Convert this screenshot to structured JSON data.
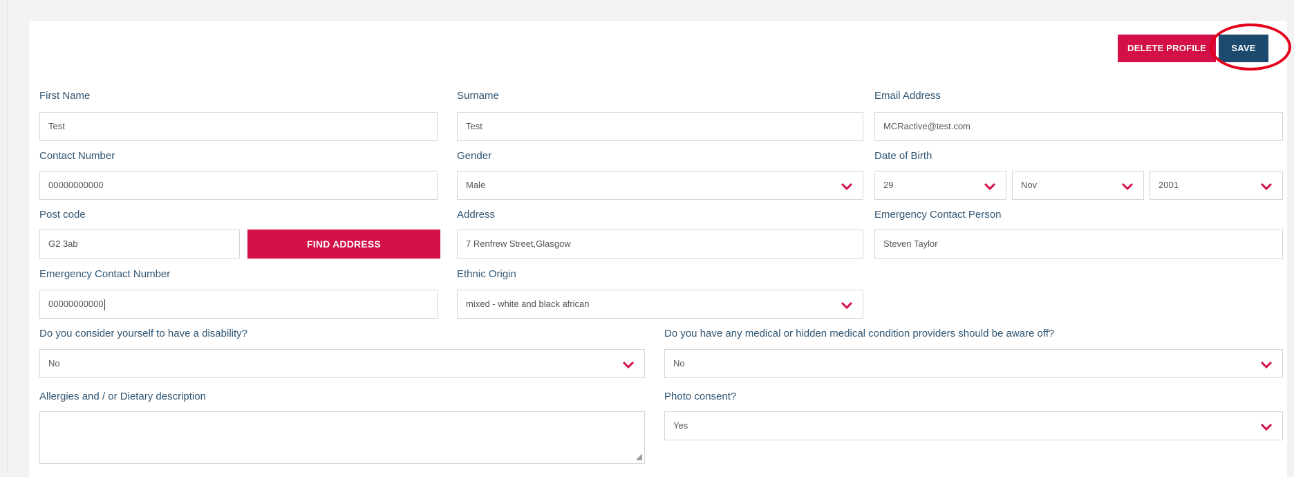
{
  "toolbar": {
    "delete_label": "DELETE PROFILE",
    "save_label": "SAVE"
  },
  "form": {
    "first_name": {
      "label": "First Name",
      "value": "Test"
    },
    "surname": {
      "label": "Surname",
      "value": "Test"
    },
    "email": {
      "label": "Email Address",
      "value": "MCRactive@test.com"
    },
    "contact_number": {
      "label": "Contact Number",
      "value": "00000000000"
    },
    "gender": {
      "label": "Gender",
      "value": "Male"
    },
    "dob": {
      "label": "Date of Birth",
      "day": "29",
      "month": "Nov",
      "year": "2001"
    },
    "postcode": {
      "label": "Post code",
      "value": "G2 3ab",
      "find_label": "FIND ADDRESS"
    },
    "address": {
      "label": "Address",
      "value": "7 Renfrew Street,Glasgow"
    },
    "emergency_person": {
      "label": "Emergency Contact Person",
      "value": "Steven Taylor"
    },
    "emergency_number": {
      "label": "Emergency Contact Number",
      "value": "00000000000"
    },
    "ethnic_origin": {
      "label": "Ethnic Origin",
      "value": "mixed - white and black african"
    },
    "disability": {
      "label": "Do you consider yourself to have a disability?",
      "value": "No"
    },
    "medical": {
      "label": "Do you have any medical or hidden medical condition providers should be aware off?",
      "value": "No"
    },
    "allergies": {
      "label": "Allergies and / or Dietary description",
      "value": ""
    },
    "photo_consent": {
      "label": "Photo consent?",
      "value": "Yes"
    }
  },
  "icons": {
    "dropdown": "chevron-down-icon",
    "resize": "resize-grip-icon"
  },
  "colors": {
    "accent_red": "#d31047",
    "navy": "#1c4a6e",
    "label": "#2f5573",
    "highlight": "#e4001b"
  }
}
